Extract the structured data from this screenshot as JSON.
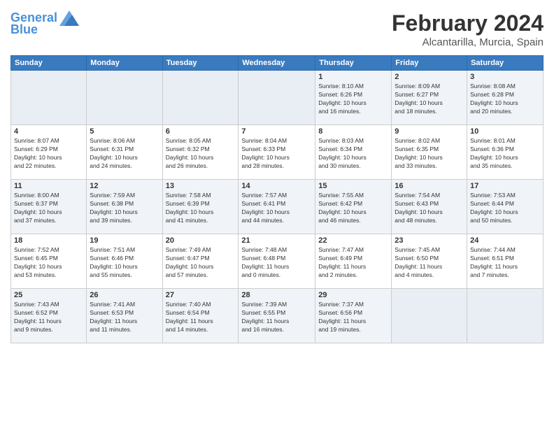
{
  "header": {
    "logo_line1": "General",
    "logo_line2": "Blue",
    "month_title": "February 2024",
    "location": "Alcantarilla, Murcia, Spain"
  },
  "days_of_week": [
    "Sunday",
    "Monday",
    "Tuesday",
    "Wednesday",
    "Thursday",
    "Friday",
    "Saturday"
  ],
  "weeks": [
    {
      "days": [
        {
          "num": "",
          "info": ""
        },
        {
          "num": "",
          "info": ""
        },
        {
          "num": "",
          "info": ""
        },
        {
          "num": "",
          "info": ""
        },
        {
          "num": "1",
          "info": "Sunrise: 8:10 AM\nSunset: 6:26 PM\nDaylight: 10 hours\nand 16 minutes."
        },
        {
          "num": "2",
          "info": "Sunrise: 8:09 AM\nSunset: 6:27 PM\nDaylight: 10 hours\nand 18 minutes."
        },
        {
          "num": "3",
          "info": "Sunrise: 8:08 AM\nSunset: 6:28 PM\nDaylight: 10 hours\nand 20 minutes."
        }
      ]
    },
    {
      "days": [
        {
          "num": "4",
          "info": "Sunrise: 8:07 AM\nSunset: 6:29 PM\nDaylight: 10 hours\nand 22 minutes."
        },
        {
          "num": "5",
          "info": "Sunrise: 8:06 AM\nSunset: 6:31 PM\nDaylight: 10 hours\nand 24 minutes."
        },
        {
          "num": "6",
          "info": "Sunrise: 8:05 AM\nSunset: 6:32 PM\nDaylight: 10 hours\nand 26 minutes."
        },
        {
          "num": "7",
          "info": "Sunrise: 8:04 AM\nSunset: 6:33 PM\nDaylight: 10 hours\nand 28 minutes."
        },
        {
          "num": "8",
          "info": "Sunrise: 8:03 AM\nSunset: 6:34 PM\nDaylight: 10 hours\nand 30 minutes."
        },
        {
          "num": "9",
          "info": "Sunrise: 8:02 AM\nSunset: 6:35 PM\nDaylight: 10 hours\nand 33 minutes."
        },
        {
          "num": "10",
          "info": "Sunrise: 8:01 AM\nSunset: 6:36 PM\nDaylight: 10 hours\nand 35 minutes."
        }
      ]
    },
    {
      "days": [
        {
          "num": "11",
          "info": "Sunrise: 8:00 AM\nSunset: 6:37 PM\nDaylight: 10 hours\nand 37 minutes."
        },
        {
          "num": "12",
          "info": "Sunrise: 7:59 AM\nSunset: 6:38 PM\nDaylight: 10 hours\nand 39 minutes."
        },
        {
          "num": "13",
          "info": "Sunrise: 7:58 AM\nSunset: 6:39 PM\nDaylight: 10 hours\nand 41 minutes."
        },
        {
          "num": "14",
          "info": "Sunrise: 7:57 AM\nSunset: 6:41 PM\nDaylight: 10 hours\nand 44 minutes."
        },
        {
          "num": "15",
          "info": "Sunrise: 7:55 AM\nSunset: 6:42 PM\nDaylight: 10 hours\nand 46 minutes."
        },
        {
          "num": "16",
          "info": "Sunrise: 7:54 AM\nSunset: 6:43 PM\nDaylight: 10 hours\nand 48 minutes."
        },
        {
          "num": "17",
          "info": "Sunrise: 7:53 AM\nSunset: 6:44 PM\nDaylight: 10 hours\nand 50 minutes."
        }
      ]
    },
    {
      "days": [
        {
          "num": "18",
          "info": "Sunrise: 7:52 AM\nSunset: 6:45 PM\nDaylight: 10 hours\nand 53 minutes."
        },
        {
          "num": "19",
          "info": "Sunrise: 7:51 AM\nSunset: 6:46 PM\nDaylight: 10 hours\nand 55 minutes."
        },
        {
          "num": "20",
          "info": "Sunrise: 7:49 AM\nSunset: 6:47 PM\nDaylight: 10 hours\nand 57 minutes."
        },
        {
          "num": "21",
          "info": "Sunrise: 7:48 AM\nSunset: 6:48 PM\nDaylight: 11 hours\nand 0 minutes."
        },
        {
          "num": "22",
          "info": "Sunrise: 7:47 AM\nSunset: 6:49 PM\nDaylight: 11 hours\nand 2 minutes."
        },
        {
          "num": "23",
          "info": "Sunrise: 7:45 AM\nSunset: 6:50 PM\nDaylight: 11 hours\nand 4 minutes."
        },
        {
          "num": "24",
          "info": "Sunrise: 7:44 AM\nSunset: 6:51 PM\nDaylight: 11 hours\nand 7 minutes."
        }
      ]
    },
    {
      "days": [
        {
          "num": "25",
          "info": "Sunrise: 7:43 AM\nSunset: 6:52 PM\nDaylight: 11 hours\nand 9 minutes."
        },
        {
          "num": "26",
          "info": "Sunrise: 7:41 AM\nSunset: 6:53 PM\nDaylight: 11 hours\nand 11 minutes."
        },
        {
          "num": "27",
          "info": "Sunrise: 7:40 AM\nSunset: 6:54 PM\nDaylight: 11 hours\nand 14 minutes."
        },
        {
          "num": "28",
          "info": "Sunrise: 7:39 AM\nSunset: 6:55 PM\nDaylight: 11 hours\nand 16 minutes."
        },
        {
          "num": "29",
          "info": "Sunrise: 7:37 AM\nSunset: 6:56 PM\nDaylight: 11 hours\nand 19 minutes."
        },
        {
          "num": "",
          "info": ""
        },
        {
          "num": "",
          "info": ""
        }
      ]
    }
  ]
}
